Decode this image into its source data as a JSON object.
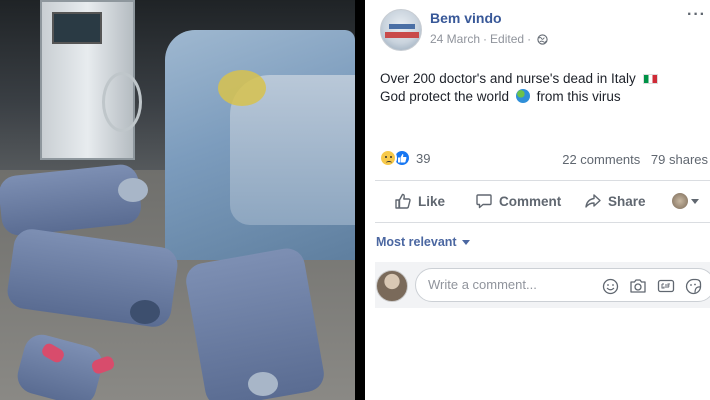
{
  "post": {
    "author": "Bem vindo",
    "date": "24 March",
    "edited": "Edited",
    "meta_sep": "·",
    "more": "···",
    "text_line1": "Over 200 doctor's and nurse's dead in Italy",
    "text_line2_a": "God protect the world",
    "text_line2_b": "from this virus",
    "reaction_count": "39",
    "comments_count": "22 comments",
    "shares_count": "79 shares",
    "actions": {
      "like": "Like",
      "comment": "Comment",
      "share": "Share"
    },
    "sort_label": "Most relevant",
    "comment_placeholder": "Write a comment..."
  },
  "icons": {
    "flag": "italy-flag-icon",
    "globe": "earth-globe-icon",
    "privacy": "public-globe-icon",
    "reactions": [
      "sad-reaction-icon",
      "like-reaction-icon"
    ],
    "composer": [
      "emoji-icon",
      "camera-icon",
      "gif-icon",
      "sticker-icon"
    ]
  },
  "colors": {
    "author": "#385898",
    "sort": "#4b67a1",
    "like_blue": "#1877f2",
    "meta": "#90949c"
  }
}
